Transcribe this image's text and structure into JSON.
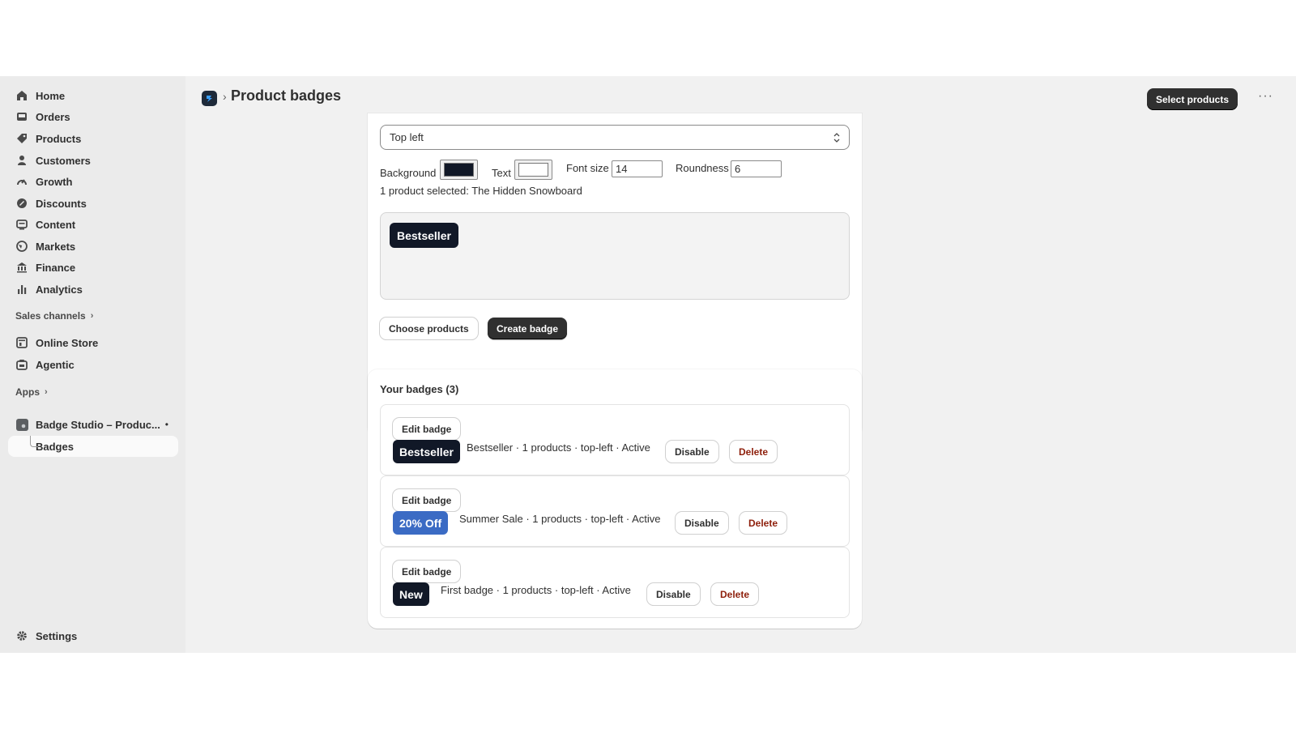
{
  "sidebar": {
    "items": [
      {
        "label": "Home",
        "icon": "home-icon"
      },
      {
        "label": "Orders",
        "icon": "inbox-icon"
      },
      {
        "label": "Products",
        "icon": "tag-icon"
      },
      {
        "label": "Customers",
        "icon": "person-icon"
      },
      {
        "label": "Growth",
        "icon": "gauge-icon"
      },
      {
        "label": "Discounts",
        "icon": "discount-icon"
      },
      {
        "label": "Content",
        "icon": "content-icon"
      },
      {
        "label": "Markets",
        "icon": "globe-icon"
      },
      {
        "label": "Finance",
        "icon": "bank-icon"
      },
      {
        "label": "Analytics",
        "icon": "bar-chart-icon"
      }
    ],
    "sales_channels_label": "Sales channels",
    "channels": [
      {
        "label": "Online Store",
        "icon": "store-icon"
      },
      {
        "label": "Agentic",
        "icon": "agent-icon"
      }
    ],
    "apps_label": "Apps",
    "app_name": "Badge Studio – Produc...",
    "app_dot": "•",
    "app_sub_item": "Badges",
    "settings_label": "Settings"
  },
  "header": {
    "separator": "›",
    "title": "Product badges",
    "primary_action": "Select products",
    "more": "···"
  },
  "form": {
    "position_value": "Top left",
    "background_label": "Background",
    "background_color": "#111827",
    "text_label": "Text",
    "text_color": "#ffffff",
    "font_size_label": "Font size",
    "font_size_value": "14",
    "roundness_label": "Roundness",
    "roundness_value": "6",
    "selection_note": "1 product selected: The Hidden Snowboard",
    "preview_badge": "Bestseller",
    "choose_products": "Choose products",
    "create_badge": "Create badge"
  },
  "badges": {
    "title": "Your badges (3)",
    "edit_label": "Edit badge",
    "disable_label": "Disable",
    "delete_label": "Delete",
    "rows": [
      {
        "pill": "Bestseller",
        "color": "#111827",
        "desc": "Bestseller · 1 products · top-left · Active"
      },
      {
        "pill": "20% Off",
        "color": "#3b6bc4",
        "desc": "Summer Sale · 1 products · top-left · Active"
      },
      {
        "pill": "New",
        "color": "#111827",
        "desc": "First badge · 1 products · top-left · Active"
      }
    ]
  }
}
